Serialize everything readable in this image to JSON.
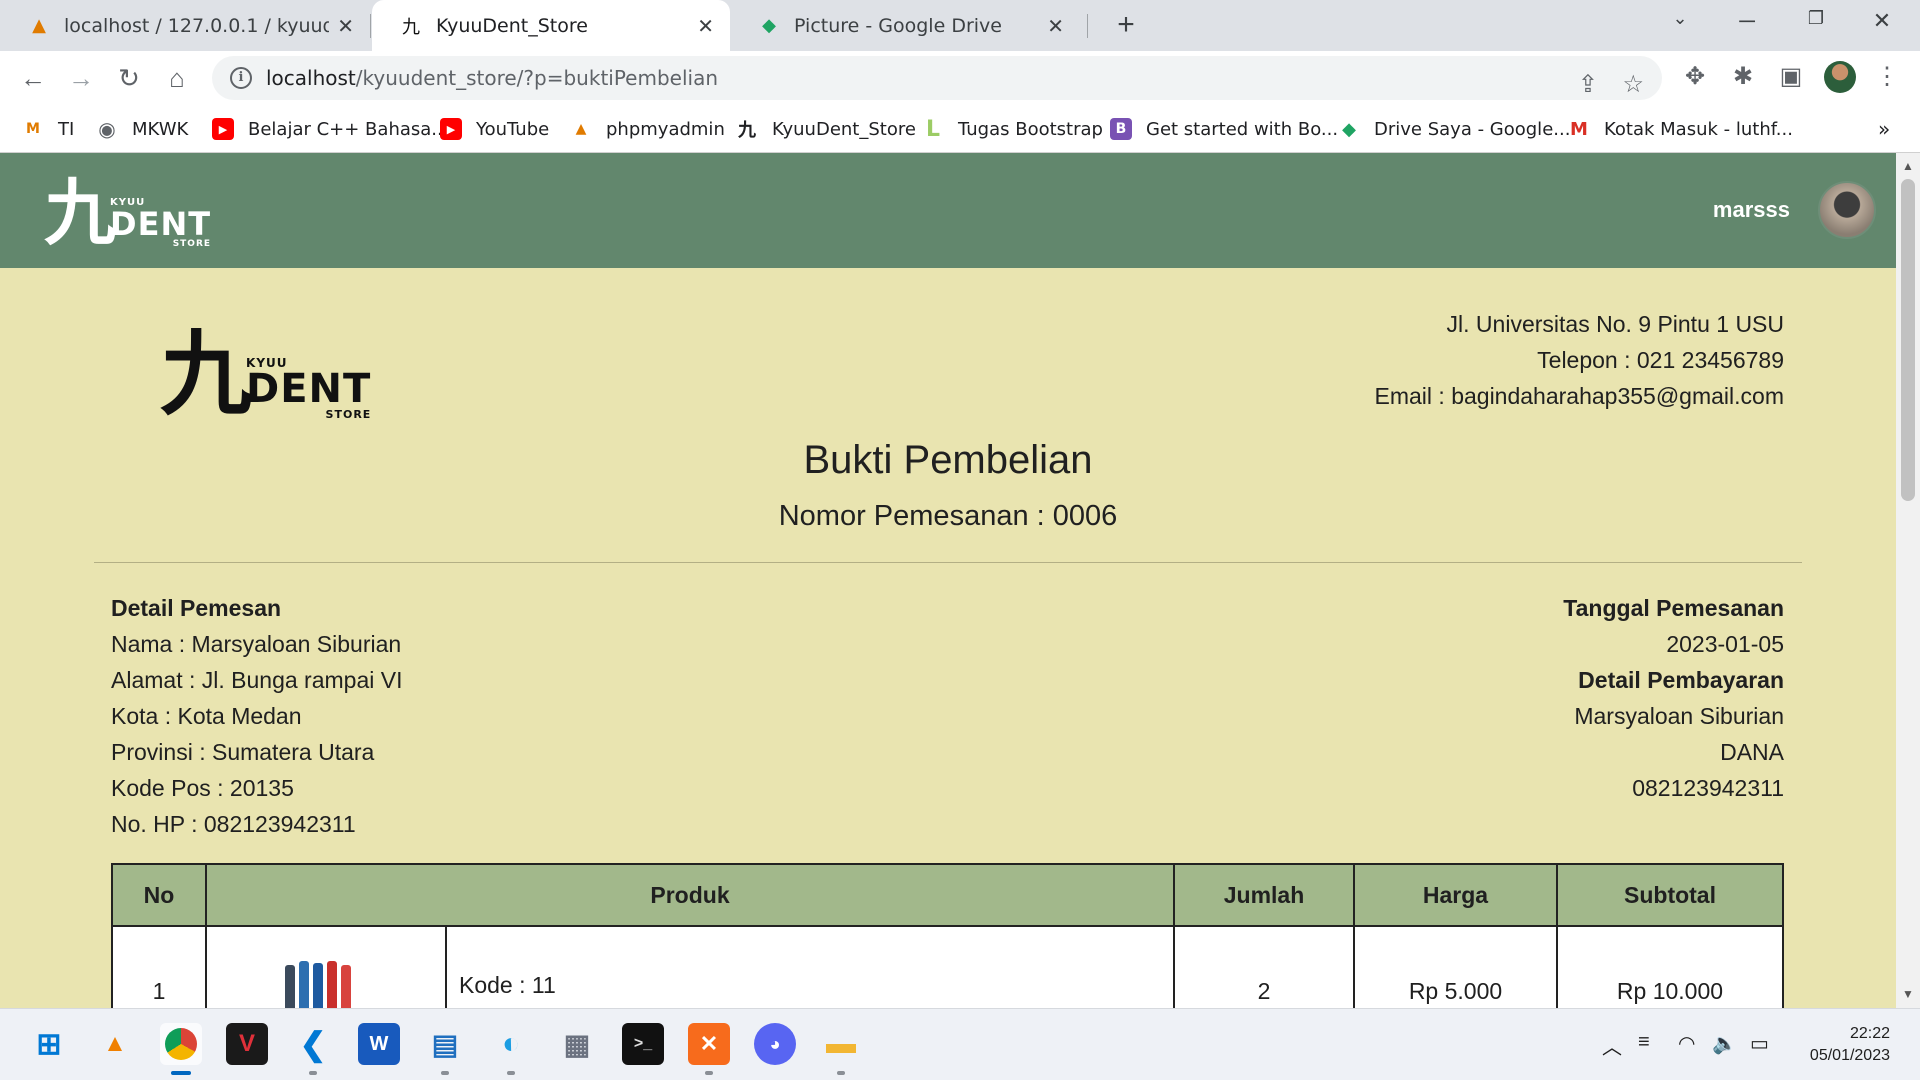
{
  "browser": {
    "tabs": [
      {
        "title": "localhost / 127.0.0.1 / kyuudent_s",
        "icon": "phpmyadmin-icon"
      },
      {
        "title": "KyuuDent_Store",
        "icon": "kyuudent-icon"
      },
      {
        "title": "Picture - Google Drive",
        "icon": "google-drive-icon"
      }
    ],
    "url_host": "localhost",
    "url_path": "/kyuudent_store/?p=buktiPembelian",
    "bookmarks": [
      {
        "label": "TI"
      },
      {
        "label": "MKWK"
      },
      {
        "label": "Belajar C++ Bahasa..."
      },
      {
        "label": "YouTube"
      },
      {
        "label": "phpmyadmin"
      },
      {
        "label": "KyuuDent_Store"
      },
      {
        "label": "Tugas Bootstrap"
      },
      {
        "label": "Get started with Bo..."
      },
      {
        "label": "Drive Saya - Google..."
      },
      {
        "label": "Kotak Masuk - luthf..."
      }
    ],
    "more_bookmarks": "»"
  },
  "site": {
    "logo": {
      "kanji": "九",
      "kyuu": "KYUU",
      "dent": "DENT",
      "store": "STORE"
    },
    "username": "marsss"
  },
  "company": {
    "address": "Jl. Universitas No. 9 Pintu 1 USU",
    "phone": "Telepon : 021 23456789",
    "email": "Email : bagindaharahap355@gmail.com"
  },
  "receipt": {
    "title": "Bukti Pembelian",
    "order_no": "Nomor Pemesanan : 0006",
    "buyer": {
      "heading": "Detail Pemesan",
      "name": "Nama : Marsyaloan Siburian",
      "address": "Alamat : Jl. Bunga rampai VI",
      "city": "Kota : Kota Medan",
      "province": "Provinsi : Sumatera Utara",
      "postal": "Kode Pos : 20135",
      "phone": "No. HP : 082123942311"
    },
    "order_date": {
      "heading": "Tanggal Pemesanan",
      "value": "2023-01-05"
    },
    "payment": {
      "heading": "Detail Pembayaran",
      "name": "Marsyaloan Siburian",
      "method": "DANA",
      "account": "082123942311"
    },
    "table": {
      "headers": {
        "no": "No",
        "product": "Produk",
        "qty": "Jumlah",
        "price": "Harga",
        "subtotal": "Subtotal"
      },
      "rows": [
        {
          "no": "1",
          "code": "Kode : 11",
          "qty": "2",
          "price": "Rp 5.000",
          "subtotal": "Rp 10.000"
        }
      ]
    }
  },
  "taskbar": {
    "time": "22:22",
    "date": "05/01/2023"
  }
}
